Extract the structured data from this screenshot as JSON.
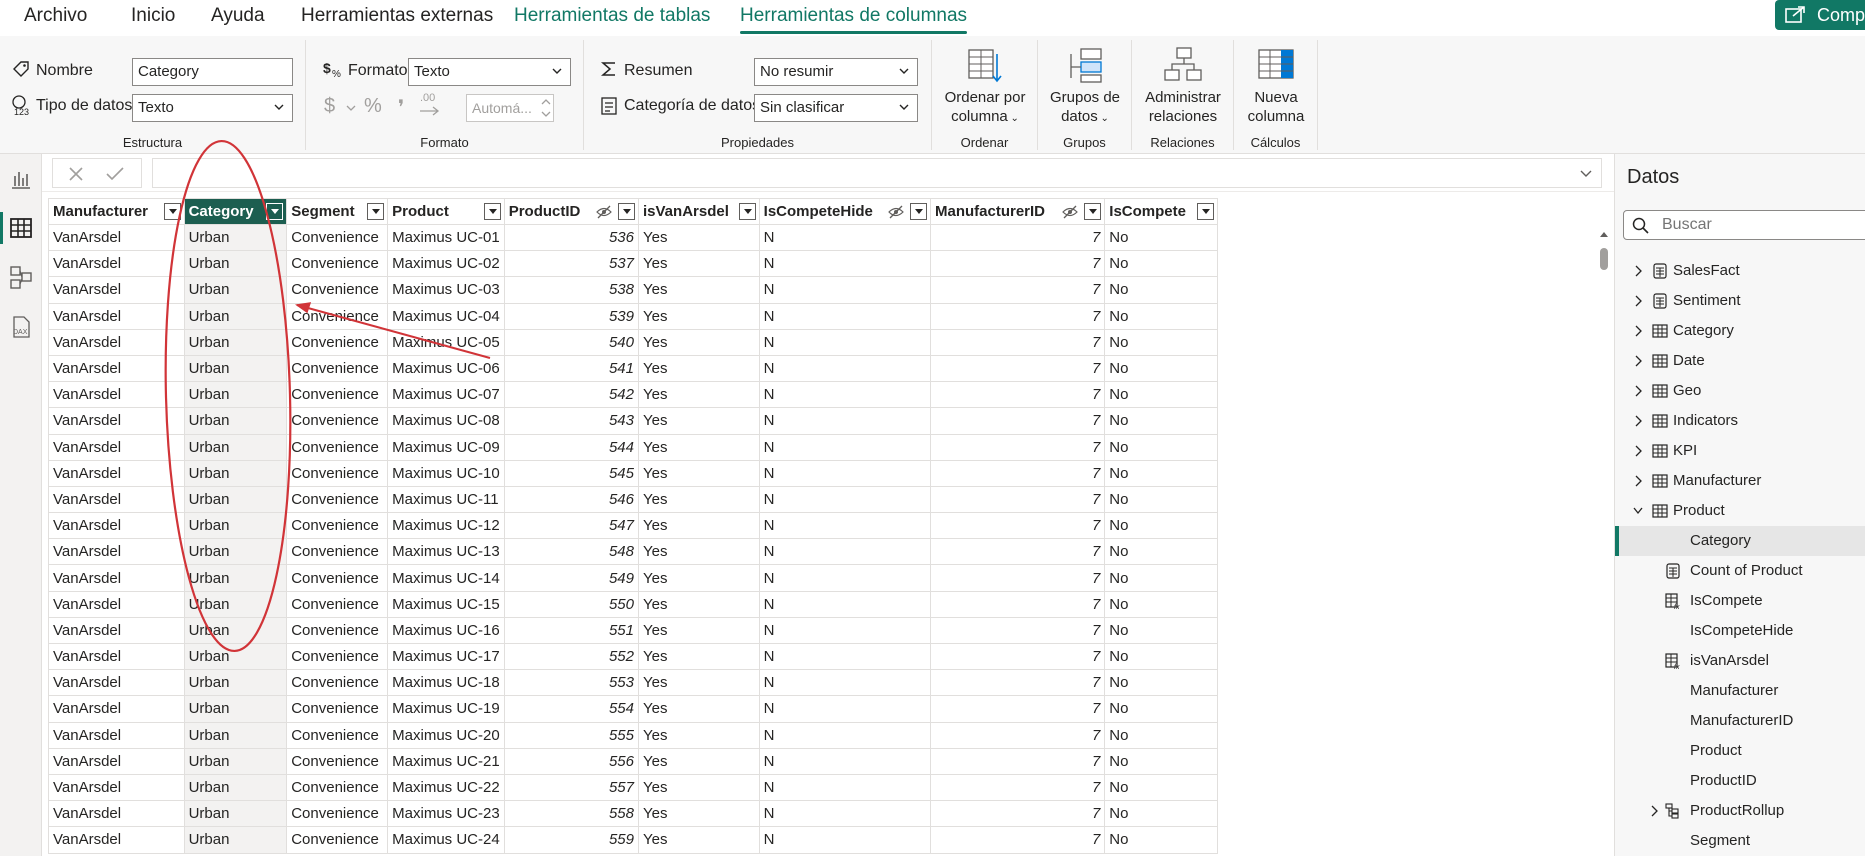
{
  "menu": {
    "tabs": [
      {
        "label": "Archivo",
        "accent": false,
        "active": false
      },
      {
        "label": "Inicio",
        "accent": false,
        "active": false
      },
      {
        "label": "Ayuda",
        "accent": false,
        "active": false
      },
      {
        "label": "Herramientas externas",
        "accent": false,
        "active": false
      },
      {
        "label": "Herramientas de tablas",
        "accent": true,
        "active": false
      },
      {
        "label": "Herramientas de columnas",
        "accent": true,
        "active": true
      }
    ],
    "share_label": "Compa"
  },
  "ribbon": {
    "estructura": {
      "title": "Estructura",
      "name_label": "Nombre",
      "name_value": "Category",
      "datatype_label": "Tipo de datos",
      "datatype_value": "Texto"
    },
    "formato": {
      "title": "Formato",
      "format_label": "Formato",
      "format_value": "Texto",
      "currency_symbol": "$",
      "percent_symbol": "%",
      "comma_symbol": "❜",
      "decimal_symbol": ".00",
      "auto_placeholder": "Automá..."
    },
    "propiedades": {
      "title": "Propiedades",
      "summary_label": "Resumen",
      "summary_value": "No resumir",
      "category_label": "Categoría de datos",
      "category_value": "Sin clasificar"
    },
    "ordenar": {
      "title": "Ordenar",
      "line1": "Ordenar por",
      "line2": "columna"
    },
    "grupos": {
      "title": "Grupos",
      "line1": "Grupos de",
      "line2": "datos"
    },
    "relaciones": {
      "title": "Relaciones",
      "line1": "Administrar",
      "line2": "relaciones"
    },
    "calculos": {
      "title": "Cálculos",
      "line1": "Nueva",
      "line2": "columna"
    }
  },
  "grid": {
    "columns": [
      "Manufacturer",
      "Category",
      "Segment",
      "Product",
      "ProductID",
      "isVanArsdel",
      "IsCompeteHide",
      "ManufacturerID",
      "IsCompete"
    ],
    "selected_column": "Category",
    "rows": [
      [
        "VanArsdel",
        "Urban",
        "Convenience",
        "Maximus UC-01",
        "536",
        "Yes",
        "N",
        "7",
        "No"
      ],
      [
        "VanArsdel",
        "Urban",
        "Convenience",
        "Maximus UC-02",
        "537",
        "Yes",
        "N",
        "7",
        "No"
      ],
      [
        "VanArsdel",
        "Urban",
        "Convenience",
        "Maximus UC-03",
        "538",
        "Yes",
        "N",
        "7",
        "No"
      ],
      [
        "VanArsdel",
        "Urban",
        "Convenience",
        "Maximus UC-04",
        "539",
        "Yes",
        "N",
        "7",
        "No"
      ],
      [
        "VanArsdel",
        "Urban",
        "Convenience",
        "Maximus UC-05",
        "540",
        "Yes",
        "N",
        "7",
        "No"
      ],
      [
        "VanArsdel",
        "Urban",
        "Convenience",
        "Maximus UC-06",
        "541",
        "Yes",
        "N",
        "7",
        "No"
      ],
      [
        "VanArsdel",
        "Urban",
        "Convenience",
        "Maximus UC-07",
        "542",
        "Yes",
        "N",
        "7",
        "No"
      ],
      [
        "VanArsdel",
        "Urban",
        "Convenience",
        "Maximus UC-08",
        "543",
        "Yes",
        "N",
        "7",
        "No"
      ],
      [
        "VanArsdel",
        "Urban",
        "Convenience",
        "Maximus UC-09",
        "544",
        "Yes",
        "N",
        "7",
        "No"
      ],
      [
        "VanArsdel",
        "Urban",
        "Convenience",
        "Maximus UC-10",
        "545",
        "Yes",
        "N",
        "7",
        "No"
      ],
      [
        "VanArsdel",
        "Urban",
        "Convenience",
        "Maximus UC-11",
        "546",
        "Yes",
        "N",
        "7",
        "No"
      ],
      [
        "VanArsdel",
        "Urban",
        "Convenience",
        "Maximus UC-12",
        "547",
        "Yes",
        "N",
        "7",
        "No"
      ],
      [
        "VanArsdel",
        "Urban",
        "Convenience",
        "Maximus UC-13",
        "548",
        "Yes",
        "N",
        "7",
        "No"
      ],
      [
        "VanArsdel",
        "Urban",
        "Convenience",
        "Maximus UC-14",
        "549",
        "Yes",
        "N",
        "7",
        "No"
      ],
      [
        "VanArsdel",
        "Urban",
        "Convenience",
        "Maximus UC-15",
        "550",
        "Yes",
        "N",
        "7",
        "No"
      ],
      [
        "VanArsdel",
        "Urban",
        "Convenience",
        "Maximus UC-16",
        "551",
        "Yes",
        "N",
        "7",
        "No"
      ],
      [
        "VanArsdel",
        "Urban",
        "Convenience",
        "Maximus UC-17",
        "552",
        "Yes",
        "N",
        "7",
        "No"
      ],
      [
        "VanArsdel",
        "Urban",
        "Convenience",
        "Maximus UC-18",
        "553",
        "Yes",
        "N",
        "7",
        "No"
      ],
      [
        "VanArsdel",
        "Urban",
        "Convenience",
        "Maximus UC-19",
        "554",
        "Yes",
        "N",
        "7",
        "No"
      ],
      [
        "VanArsdel",
        "Urban",
        "Convenience",
        "Maximus UC-20",
        "555",
        "Yes",
        "N",
        "7",
        "No"
      ],
      [
        "VanArsdel",
        "Urban",
        "Convenience",
        "Maximus UC-21",
        "556",
        "Yes",
        "N",
        "7",
        "No"
      ],
      [
        "VanArsdel",
        "Urban",
        "Convenience",
        "Maximus UC-22",
        "557",
        "Yes",
        "N",
        "7",
        "No"
      ],
      [
        "VanArsdel",
        "Urban",
        "Convenience",
        "Maximus UC-23",
        "558",
        "Yes",
        "N",
        "7",
        "No"
      ],
      [
        "VanArsdel",
        "Urban",
        "Convenience",
        "Maximus UC-24",
        "559",
        "Yes",
        "N",
        "7",
        "No"
      ]
    ]
  },
  "datapane": {
    "title": "Datos",
    "search_placeholder": "Buscar",
    "items": [
      {
        "label": "SalesFact",
        "icon": "calculator-table-icon",
        "expander": "collapsed",
        "level": 0,
        "selected": false
      },
      {
        "label": "Sentiment",
        "icon": "calculator-table-icon",
        "expander": "collapsed",
        "level": 0,
        "selected": false
      },
      {
        "label": "Category",
        "icon": "table-icon",
        "expander": "collapsed",
        "level": 0,
        "selected": false
      },
      {
        "label": "Date",
        "icon": "table-icon",
        "expander": "collapsed",
        "level": 0,
        "selected": false
      },
      {
        "label": "Geo",
        "icon": "table-icon",
        "expander": "collapsed",
        "level": 0,
        "selected": false
      },
      {
        "label": "Indicators",
        "icon": "table-icon",
        "expander": "collapsed",
        "level": 0,
        "selected": false
      },
      {
        "label": "KPI",
        "icon": "table-icon",
        "expander": "collapsed",
        "level": 0,
        "selected": false
      },
      {
        "label": "Manufacturer",
        "icon": "table-icon",
        "expander": "collapsed",
        "level": 0,
        "selected": false
      },
      {
        "label": "Product",
        "icon": "table-icon",
        "expander": "expanded",
        "level": 0,
        "selected": false
      },
      {
        "label": "Category",
        "icon": "",
        "expander": "",
        "level": 1,
        "selected": true
      },
      {
        "label": "Count of Product",
        "icon": "calculator-icon",
        "expander": "",
        "level": 1,
        "selected": false
      },
      {
        "label": "IsCompete",
        "icon": "calculated-column-icon",
        "expander": "",
        "level": 1,
        "selected": false
      },
      {
        "label": "IsCompeteHide",
        "icon": "",
        "expander": "",
        "level": 1,
        "selected": false
      },
      {
        "label": "isVanArsdel",
        "icon": "calculated-column-icon",
        "expander": "",
        "level": 1,
        "selected": false
      },
      {
        "label": "Manufacturer",
        "icon": "",
        "expander": "",
        "level": 1,
        "selected": false
      },
      {
        "label": "ManufacturerID",
        "icon": "",
        "expander": "",
        "level": 1,
        "selected": false
      },
      {
        "label": "Product",
        "icon": "",
        "expander": "",
        "level": 1,
        "selected": false
      },
      {
        "label": "ProductID",
        "icon": "",
        "expander": "",
        "level": 1,
        "selected": false
      },
      {
        "label": "ProductRollup",
        "icon": "hierarchy-icon",
        "expander": "collapsed",
        "level": 1,
        "selected": false
      },
      {
        "label": "Segment",
        "icon": "",
        "expander": "",
        "level": 1,
        "selected": false
      }
    ]
  },
  "colors": {
    "accent": "#117865",
    "selected_header": "#1c5e50",
    "annotation": "#d13438"
  }
}
